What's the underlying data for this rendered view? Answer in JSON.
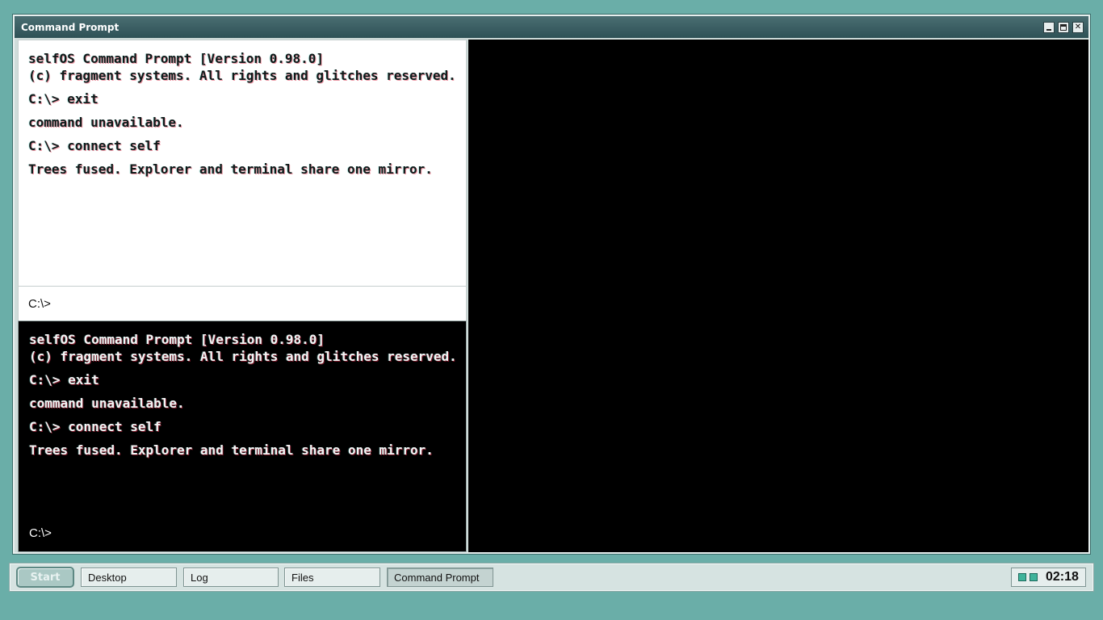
{
  "window": {
    "title": "Command Prompt"
  },
  "terminal": {
    "header_line1": "selfOS Command Prompt [Version 0.98.0]",
    "header_line2": "(c) fragment systems. All rights and glitches reserved.",
    "cmd1": "C:\\> exit",
    "out1": "command unavailable.",
    "cmd2": "C:\\> connect self",
    "out2": "Trees fused. Explorer and terminal share one mirror.",
    "prompt": "C:\\>"
  },
  "taskbar": {
    "start_label": "Start",
    "tasks": [
      {
        "label": "Desktop"
      },
      {
        "label": "Log"
      },
      {
        "label": "Files"
      },
      {
        "label": "Command Prompt"
      }
    ],
    "clock": "02:18"
  },
  "colors": {
    "desktop": "#6aaea8",
    "titlebar": "#2e5156",
    "terminal_bg": "#000000",
    "indicator": "#3fb39b"
  }
}
